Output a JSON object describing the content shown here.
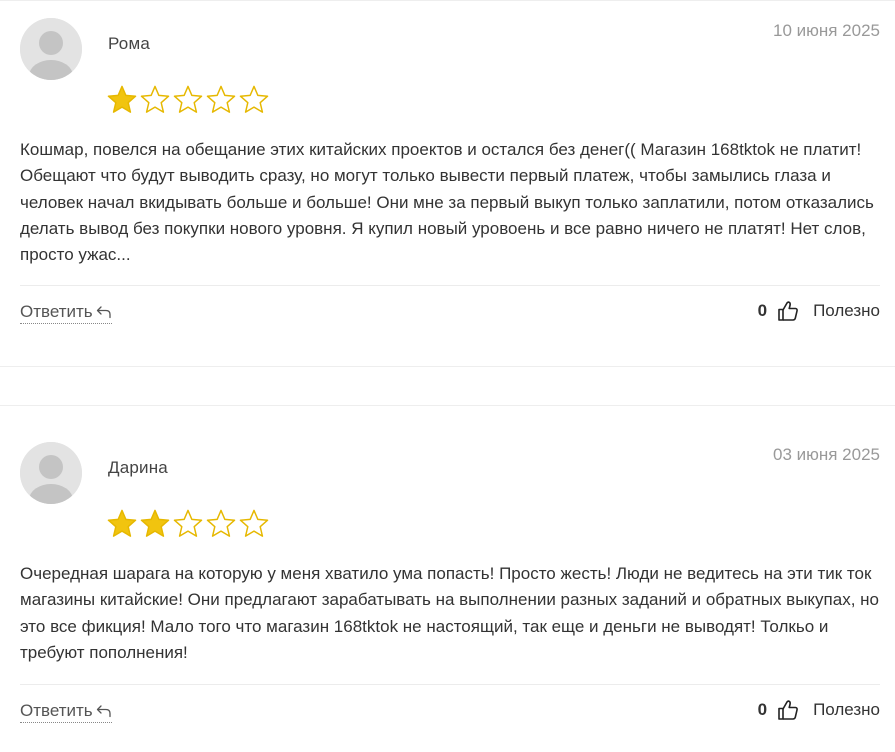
{
  "colors": {
    "star_filled": "#f1c40f",
    "star_outline": "#e6b800",
    "text": "#333333",
    "muted": "#999999"
  },
  "reviews": [
    {
      "author": "Рома",
      "date": "10 июня 2025",
      "rating": 1,
      "max_rating": 5,
      "text": "Кошмар, повелся на обещание этих китайских проектов и остался без денег(( Магазин 168tktok не платит! Обещают что будут выводить сразу, но могут только вывести первый платеж, чтобы замылись глаза и человек начал вкидывать больше и больше! Они мне за первый выкуп только заплатили, потом отказались делать вывод без покупки нового уровня. Я купил новый уровоень и все равно ничего не платят! Нет слов, просто ужас...",
      "reply_label": "Ответить",
      "helpful_count": "0",
      "helpful_label": "Полезно"
    },
    {
      "author": "Дарина",
      "date": "03 июня 2025",
      "rating": 2,
      "max_rating": 5,
      "text": "Очередная шарага на которую у меня хватило ума попасть! Просто жесть! Люди не ведитесь на эти тик ток магазины китайские! Они предлагают зарабатывать на выполнении разных заданий и обратных выкупах, но это все фикция! Мало того что магазин 168tktok не настоящий, так еще и деньги не выводят! Толкьо и требуют пополнения!",
      "reply_label": "Ответить",
      "helpful_count": "0",
      "helpful_label": "Полезно"
    }
  ],
  "icons": {
    "avatar": "user-avatar-icon",
    "star": "star-icon",
    "reply": "reply-arrow-icon",
    "thumb": "thumbs-up-icon"
  }
}
